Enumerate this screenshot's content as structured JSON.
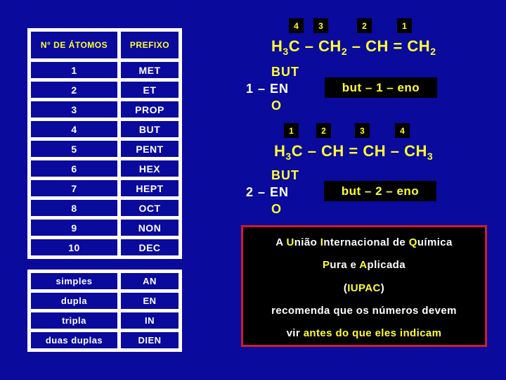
{
  "colors": {
    "background": "#0a0a9c",
    "highlight_yellow": "#ffff33",
    "box_black": "#000000",
    "box_border_red": "#d01c2c",
    "table_border_white": "#ffffff"
  },
  "prefix_table": {
    "headers": [
      "N° DE ÁTOMOS",
      "PREFIXO"
    ],
    "rows": [
      {
        "atoms": "1",
        "prefix": "MET"
      },
      {
        "atoms": "2",
        "prefix": "ET"
      },
      {
        "atoms": "3",
        "prefix": "PROP"
      },
      {
        "atoms": "4",
        "prefix": "BUT"
      },
      {
        "atoms": "5",
        "prefix": "PENT"
      },
      {
        "atoms": "6",
        "prefix": "HEX"
      },
      {
        "atoms": "7",
        "prefix": "HEPT"
      },
      {
        "atoms": "8",
        "prefix": "OCT"
      },
      {
        "atoms": "9",
        "prefix": "NON"
      },
      {
        "atoms": "10",
        "prefix": "DEC"
      }
    ]
  },
  "bond_table": {
    "rows": [
      {
        "bond": "simples",
        "infix": "AN"
      },
      {
        "bond": "dupla",
        "infix": "EN"
      },
      {
        "bond": "tripla",
        "infix": "IN"
      },
      {
        "bond": "duas duplas",
        "infix": "DIEN"
      }
    ]
  },
  "example1": {
    "numbering": [
      "4",
      "3",
      "2",
      "1"
    ],
    "formula": {
      "p1": "H",
      "s1": "3",
      "p2": "C – CH",
      "s2": "2",
      "p3": " – CH = CH",
      "s3": "2"
    },
    "breakdown": {
      "prefix": "BUT",
      "locant": "1 – ",
      "infix": "EN",
      "suffix": "O"
    },
    "name": "but – 1 – eno"
  },
  "example2": {
    "numbering": [
      "1",
      "2",
      "3",
      "4"
    ],
    "formula": {
      "p1": "H",
      "s1": "3",
      "p2": "C – CH = CH – CH",
      "s2": "3"
    },
    "breakdown": {
      "prefix": "BUT",
      "locant": "2 – ",
      "infix": "EN",
      "suffix": "O"
    },
    "name": "but – 2 – eno"
  },
  "iupac_note": {
    "line1": {
      "a": "A ",
      "U": "U",
      "b": "nião ",
      "I": "I",
      "c": "nternacional de ",
      "Q": "Q",
      "d": "uímica"
    },
    "line2": {
      "P": "P",
      "a": "ura e ",
      "A": "A",
      "b": "plicada"
    },
    "line3": {
      "open": "(",
      "acronym": "IUPAC",
      "close": ")"
    },
    "line4": "recomenda que os números devem",
    "line5": {
      "a": "vir ",
      "hl": "antes do que eles indicam"
    }
  }
}
